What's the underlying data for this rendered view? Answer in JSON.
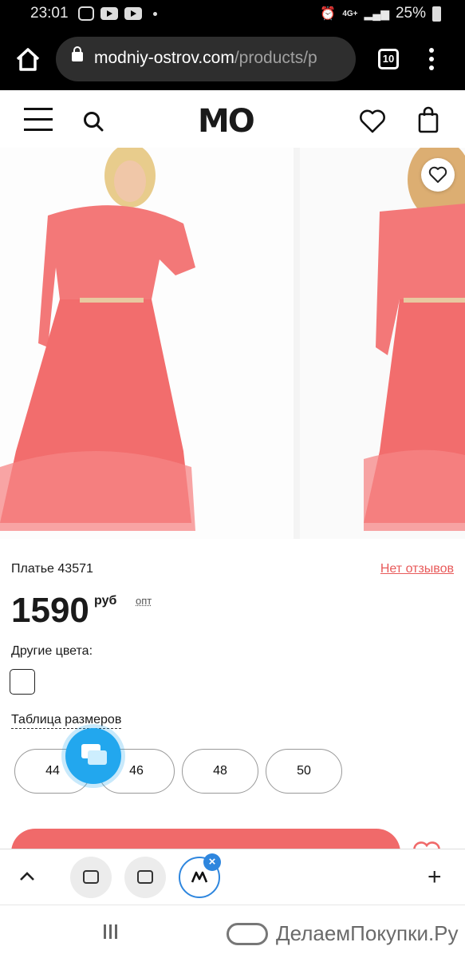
{
  "status_bar": {
    "time": "23:01",
    "network": "4G+",
    "battery": "25%"
  },
  "browser": {
    "url_domain": "modniy-ostrov.com",
    "url_path": "/products/p",
    "tab_count": "10"
  },
  "site": {
    "logo": "MO"
  },
  "product": {
    "name": "Платье 43571",
    "reviews_link": "Нет отзывов",
    "price": "1590",
    "currency": "руб",
    "wholesale_link": "опт",
    "other_colors_label": "Другие цвета:",
    "size_table_link": "Таблица размеров",
    "sizes": [
      "44",
      "46",
      "48",
      "50"
    ],
    "dress_color": "#f26d6d"
  },
  "bottom_bar": {
    "tab_plus": "+"
  },
  "watermark": "ДелаемПокупки.Ру",
  "colors": {
    "accent": "#f06a6a",
    "chat": "#22a7ee",
    "active_tab": "#2e86de"
  }
}
